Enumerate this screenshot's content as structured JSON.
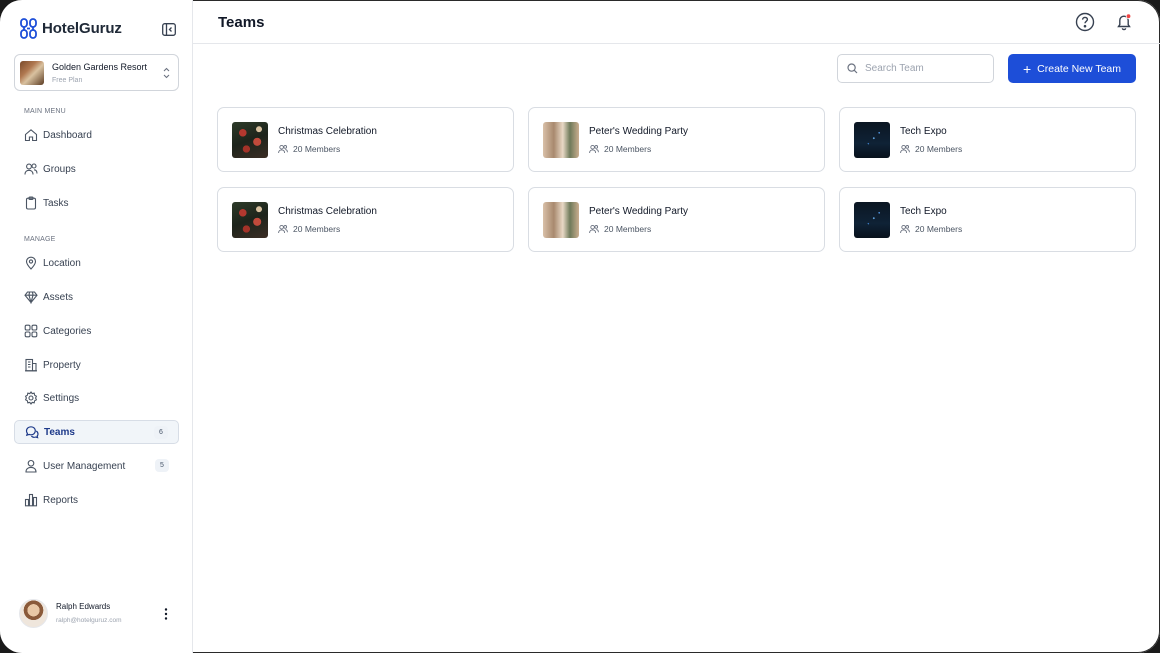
{
  "app": {
    "name": "HotelGuruz"
  },
  "property": {
    "name": "Golden Gardens Resort",
    "plan": "Free Plan"
  },
  "sidebar": {
    "main_menu_label": "MAIN MENU",
    "manage_label": "MANAGE",
    "main_items": [
      {
        "label": "Dashboard",
        "icon": "home-icon"
      },
      {
        "label": "Groups",
        "icon": "users-icon"
      },
      {
        "label": "Tasks",
        "icon": "clipboard-icon"
      }
    ],
    "manage_items": [
      {
        "label": "Location",
        "icon": "map-pin-icon"
      },
      {
        "label": "Assets",
        "icon": "diamond-icon"
      },
      {
        "label": "Categories",
        "icon": "grid-icon"
      },
      {
        "label": "Property",
        "icon": "building-icon"
      },
      {
        "label": "Settings",
        "icon": "gear-icon"
      },
      {
        "label": "Teams",
        "icon": "chat-icon",
        "badge": "6",
        "active": true
      },
      {
        "label": "User Management",
        "icon": "user-icon",
        "badge": "5"
      },
      {
        "label": "Reports",
        "icon": "chart-icon"
      }
    ]
  },
  "user": {
    "name": "Ralph Edwards",
    "email": "ralph@hotelguruz.com"
  },
  "header": {
    "title": "Teams"
  },
  "toolbar": {
    "search_placeholder": "Search Team",
    "create_label": "Create New Team"
  },
  "teams": [
    {
      "name": "Christmas Celebration",
      "members": "20 Members",
      "thumb": "christmas"
    },
    {
      "name": "Peter's Wedding Party",
      "members": "20 Members",
      "thumb": "wedding"
    },
    {
      "name": "Tech Expo",
      "members": "20 Members",
      "thumb": "tech"
    },
    {
      "name": "Christmas Celebration",
      "members": "20 Members",
      "thumb": "christmas"
    },
    {
      "name": "Peter's Wedding Party",
      "members": "20 Members",
      "thumb": "wedding"
    },
    {
      "name": "Tech Expo",
      "members": "20 Members",
      "thumb": "tech"
    }
  ],
  "colors": {
    "accent": "#1d4ed8",
    "active_text": "#1e3a8a",
    "notification_dot": "#ef4444"
  }
}
